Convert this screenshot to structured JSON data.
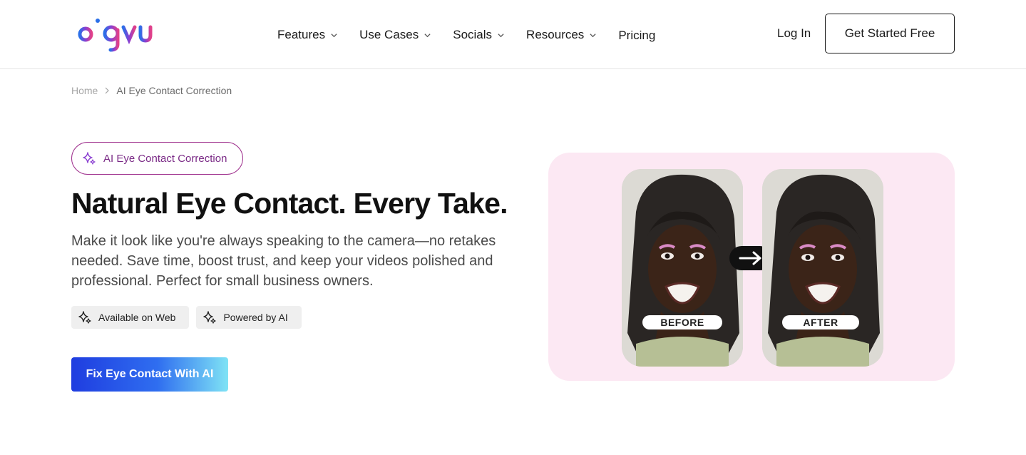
{
  "brand": {
    "name": "bigvu",
    "colors": {
      "blue": "#2b6fe8",
      "magenta": "#c2307a",
      "accent": "#7a2a86"
    }
  },
  "nav": {
    "items": [
      {
        "label": "Features",
        "dropdown": true
      },
      {
        "label": "Use Cases",
        "dropdown": true
      },
      {
        "label": "Socials",
        "dropdown": true
      },
      {
        "label": "Resources",
        "dropdown": true
      },
      {
        "label": "Pricing",
        "dropdown": false
      }
    ],
    "login": "Log In",
    "cta": "Get Started Free"
  },
  "breadcrumb": {
    "home": "Home",
    "current": "AI Eye Contact Correction"
  },
  "hero": {
    "badge": "AI Eye Contact Correction",
    "title": "Natural Eye Contact. Every Take.",
    "description": "Make it look like you're always speaking to the camera—no retakes needed. Save time, boost trust, and keep your videos polished and professional. Perfect for small business owners.",
    "chips": [
      "Available on Web",
      "Powered by AI"
    ],
    "cta": "Fix Eye Contact With AI",
    "image": {
      "before_label": "BEFORE",
      "after_label": "AFTER"
    }
  }
}
